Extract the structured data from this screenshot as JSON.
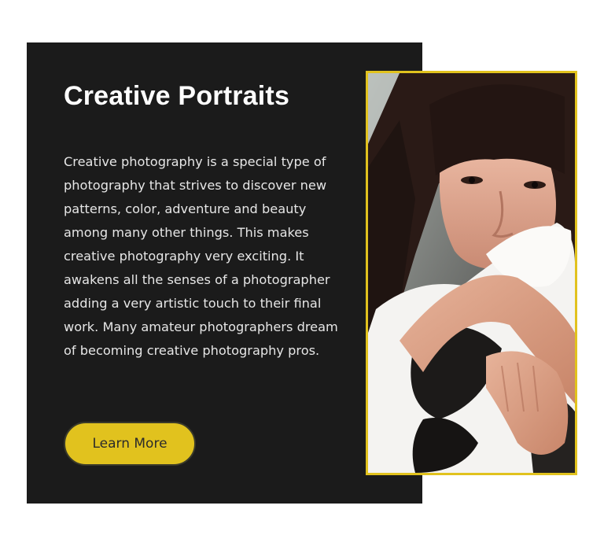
{
  "card": {
    "title": "Creative Portraits",
    "description": "Creative photography is a special type of photography that strives to discover new patterns, color, adventure and beauty among many other things. This makes creative photography very exciting. It awakens all the senses of a photographer adding a very artistic touch to their final work. Many amateur photographers dream of becoming creative photography pros.",
    "button_label": "Learn More"
  },
  "image": {
    "subject": "portrait-woman-with-cat"
  },
  "colors": {
    "panel_background": "#1b1b1b",
    "accent": "#e1c21e",
    "title_text": "#ffffff",
    "body_text": "#e6e6e6",
    "page_background": "#ffffff"
  }
}
